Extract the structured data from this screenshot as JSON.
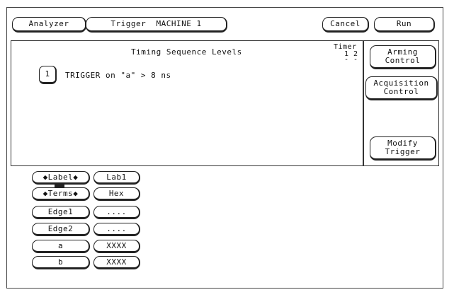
{
  "top_bar": {
    "analyzer_label": "Analyzer",
    "trigger_label": "Trigger  MACHINE 1",
    "cancel_label": "Cancel",
    "run_label": "Run"
  },
  "sequence": {
    "title": "Timing Sequence Levels",
    "timer_label": "Timer",
    "timer_numbers": "1 2",
    "timer_dashes": "- -",
    "level_number": "1",
    "level_text": "TRIGGER on \"a\" > 8 ns"
  },
  "side_menu": {
    "arming_line1": "Arming",
    "arming_line2": "Control",
    "acquisition_line1": "Acquisition",
    "acquisition_line2": "Control",
    "modify_line1": "Modify",
    "modify_line2": "Trigger"
  },
  "terms": {
    "label_selector": "◆Label◆",
    "terms_selector": "◆Terms◆",
    "label_value": "Lab1",
    "base_value": "Hex",
    "rows": [
      {
        "name": "Edge1",
        "value": "...."
      },
      {
        "name": "Edge2",
        "value": "...."
      },
      {
        "name": "a",
        "value": "XXXX"
      },
      {
        "name": "b",
        "value": "XXXX"
      }
    ]
  }
}
